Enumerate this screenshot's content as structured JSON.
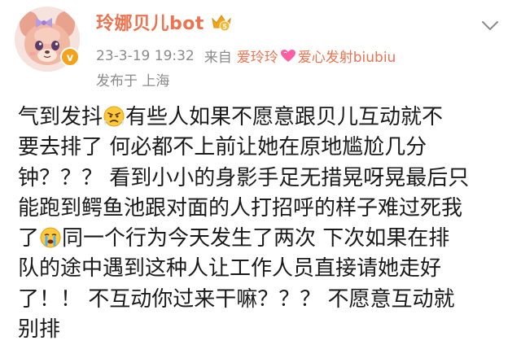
{
  "post": {
    "author": "玲娜贝儿bot",
    "crown_badge": "crown-level-icon",
    "timestamp": "23-3-19 19:32",
    "source_prefix": "来自",
    "source_part1": "爱玲玲",
    "source_part2": "爱心发射biubiu",
    "location": "发布于 上海",
    "body_lines": [
      {
        "before": "气到发抖",
        "emoji": "angry-face-icon",
        "after": "有些人如果不愿意跟贝儿互动就不"
      },
      {
        "text": "要去排了 何必都不上前让她在原地尴尬几分"
      },
      {
        "text": "钟？？？ 看到小小的身影手足无措晃呀晃最后只"
      },
      {
        "text": "能跑到鳄鱼池跟对面的人打招呼的样子难过死我"
      },
      {
        "before": "了",
        "emoji": "crying-face-icon",
        "after": "同一个行为今天发生了两次 下次如果在排"
      },
      {
        "text": "队的途中遇到这种人让工作人员直接请她走好"
      },
      {
        "text": "了！！ 不互动你过来干嘛？？？ 不愿意互动就"
      },
      {
        "text": "别排"
      }
    ]
  },
  "colors": {
    "accent": "#eb7350",
    "meta": "#8a8a8a",
    "verified": "#f2a21b",
    "heart": "#ff5fa2"
  }
}
